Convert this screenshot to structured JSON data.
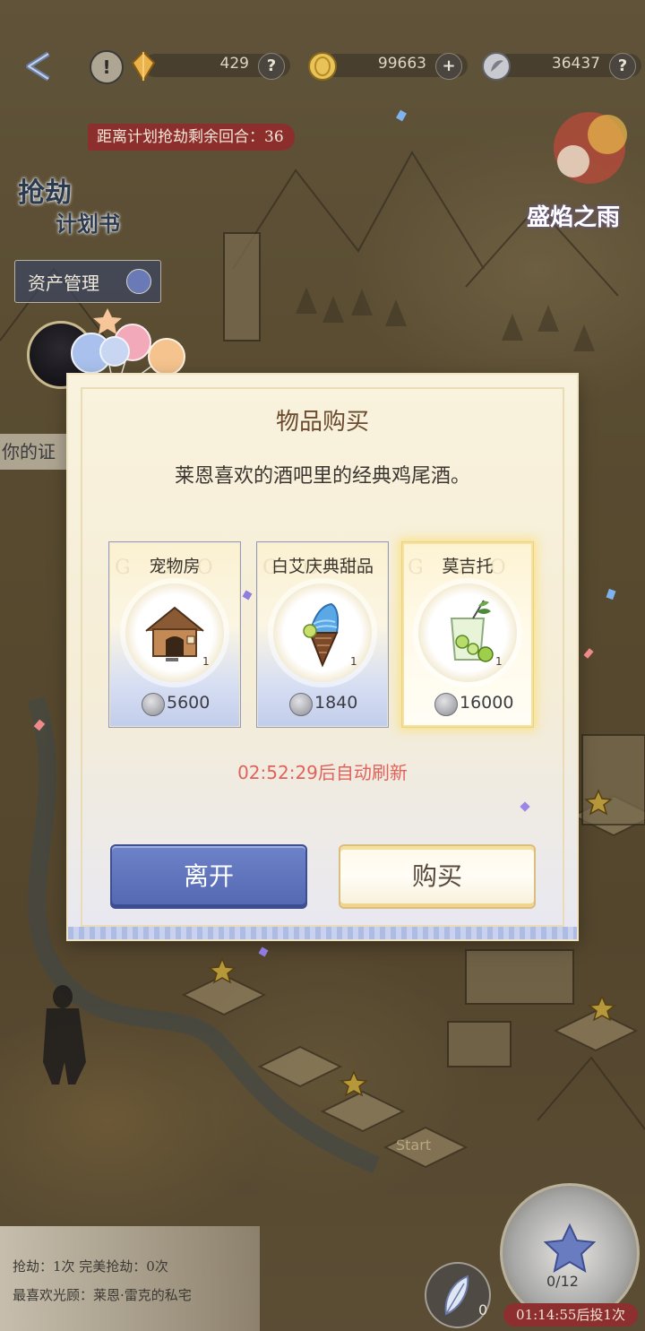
{
  "topbar": {
    "currencies": [
      {
        "icon": "crystal-icon",
        "amount": "429",
        "action": "?"
      },
      {
        "icon": "gold-coin-icon",
        "amount": "99663",
        "action": "+"
      },
      {
        "icon": "silver-coin-icon",
        "amount": "36437",
        "action": "?"
      }
    ],
    "alert_symbol": "!"
  },
  "hud": {
    "countdown": "距离计划抢劫剩余回合：36",
    "plan_title_line1": "抢劫",
    "plan_title_line2": "计划书",
    "asset_button": "资产管理",
    "proof_tab": "你的证",
    "event_banner": "盛焰之雨"
  },
  "bottom": {
    "stats_line1": "抢劫：1次  完美抢劫：0次",
    "stats_line2": "最喜欢光顾：莱恩·雷克的私宅",
    "dice_count": "0/12",
    "dice_timer": "01:14:55后投1次",
    "feather_count": "0",
    "board_start": "Start"
  },
  "modal": {
    "title": "物品购买",
    "description": "莱恩喜欢的酒吧里的经典鸡尾酒。",
    "watermark": "GOODS",
    "items": [
      {
        "name": "宠物房",
        "quantity": "1",
        "price": "5600",
        "icon": "pet-house-icon",
        "selected": false
      },
      {
        "name": "白艾庆典甜品",
        "quantity": "1",
        "price": "1840",
        "icon": "ice-cream-icon",
        "selected": false
      },
      {
        "name": "莫吉托",
        "quantity": "1",
        "price": "16000",
        "icon": "mojito-icon",
        "selected": true
      }
    ],
    "refresh_text": "02:52:29后自动刷新",
    "leave_button": "离开",
    "buy_button": "购买"
  }
}
